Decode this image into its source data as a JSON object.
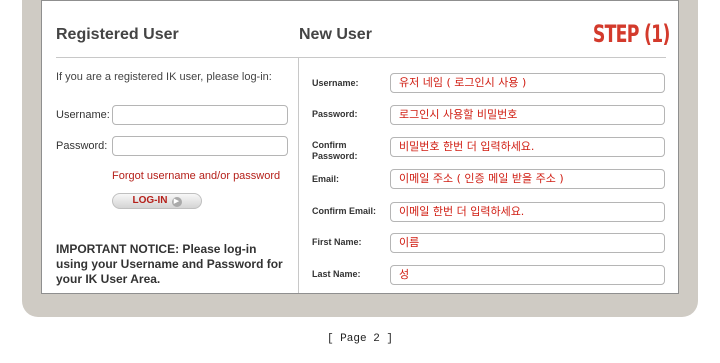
{
  "step_label": "STEP (1)",
  "registered": {
    "heading": "Registered User",
    "intro": "If you are a registered IK user, please log-in:",
    "username_label": "Username:",
    "password_label": "Password:",
    "username_value": "",
    "password_value": "",
    "forgot_link": "Forgot username and/or password",
    "login_button": "LOG-IN",
    "notice": "IMPORTANT NOTICE: Please log-in using your Username and Password for your IK User Area."
  },
  "new_user": {
    "heading": "New User",
    "fields": [
      {
        "label": "Username:",
        "value": "유저 네임 ( 로그인시 사용 )"
      },
      {
        "label": "Password:",
        "value": "로그인시 사용할 비밀번호"
      },
      {
        "label": "Confirm Password:",
        "value": "비밀번호 한번 더 입력하세요."
      },
      {
        "label": "Email:",
        "value": "이메일 주소 ( 인증 메일 받을 주소 )"
      },
      {
        "label": "Confirm Email:",
        "value": "이메일 한번 더 입력하세요."
      },
      {
        "label": "First Name:",
        "value": "이름"
      },
      {
        "label": "Last Name:",
        "value": "성"
      }
    ]
  },
  "footer": "[ Page 2 ]",
  "colors": {
    "accent_red": "#d33a2c",
    "frame": "#cfcbc4"
  }
}
